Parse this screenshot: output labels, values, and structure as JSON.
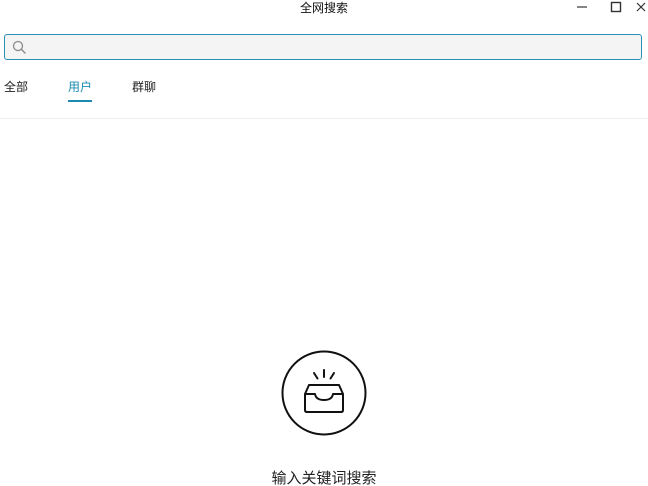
{
  "window": {
    "title": "全网搜索"
  },
  "search": {
    "value": "",
    "placeholder": ""
  },
  "tabs": [
    {
      "label": "全部",
      "active": false
    },
    {
      "label": "用户",
      "active": true
    },
    {
      "label": "群聊",
      "active": false
    }
  ],
  "empty_state": {
    "icon": "inbox-icon",
    "message": "输入关键词搜索"
  },
  "colors": {
    "accent": "#1a8ab0",
    "search_border": "#2a8fb8",
    "search_bg": "#f4f4f4",
    "text": "#222222"
  }
}
